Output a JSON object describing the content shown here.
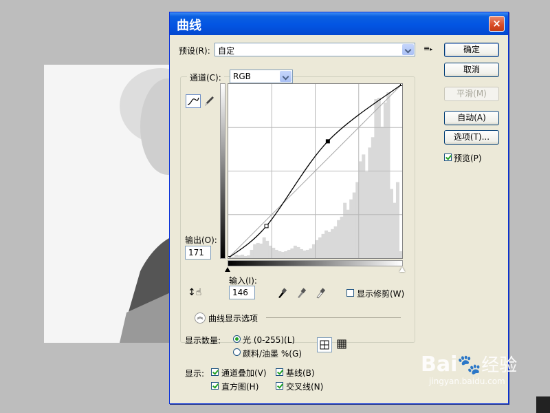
{
  "dialog": {
    "title": "曲线",
    "close_label": "×"
  },
  "preset": {
    "label": "预设(R):",
    "value": "自定"
  },
  "channel": {
    "label": "通道(C):",
    "value": "RGB"
  },
  "buttons": {
    "ok": "确定",
    "cancel": "取消",
    "smooth": "平滑(M)",
    "auto": "自动(A)",
    "options": "选项(T)..."
  },
  "preview": {
    "label": "预览(P)",
    "checked": true
  },
  "output": {
    "label": "输出(O):",
    "value": "171"
  },
  "input": {
    "label": "输入(I):",
    "value": "146"
  },
  "show_clipping": {
    "label": "显示修剪(W)",
    "checked": false
  },
  "curve_options": {
    "label": "曲线显示选项"
  },
  "show_amount": {
    "label": "显示数量:",
    "options": [
      {
        "label": "光 (0-255)(L)",
        "selected": true
      },
      {
        "label": "颜料/油墨 %(G)",
        "selected": false
      }
    ]
  },
  "show": {
    "label": "显示:",
    "channel_overlay": {
      "label": "通道叠加(V)",
      "checked": true
    },
    "baseline": {
      "label": "基线(B)",
      "checked": true
    },
    "histogram": {
      "label": "直方图(H)",
      "checked": true
    },
    "intersection": {
      "label": "交叉线(N)",
      "checked": true
    }
  },
  "watermark": {
    "brand": "Bai",
    "brand2": "经验",
    "url": "jingyan.baidu.com"
  },
  "chart_data": {
    "type": "line",
    "xlim": [
      0,
      255
    ],
    "ylim": [
      0,
      255
    ],
    "control_points": [
      {
        "x": 0,
        "y": 0
      },
      {
        "x": 56,
        "y": 47
      },
      {
        "x": 146,
        "y": 171
      },
      {
        "x": 255,
        "y": 255
      }
    ],
    "baseline": [
      [
        0,
        0
      ],
      [
        255,
        255
      ]
    ],
    "histogram": [
      0,
      2,
      5,
      4,
      5,
      3,
      4,
      12,
      20,
      22,
      21,
      30,
      25,
      18,
      15,
      12,
      10,
      9,
      10,
      12,
      14,
      18,
      16,
      13,
      11,
      12,
      14,
      20,
      26,
      30,
      35,
      40,
      38,
      42,
      46,
      55,
      60,
      80,
      70,
      85,
      95,
      110,
      140,
      150,
      125,
      160,
      175,
      230,
      232,
      190,
      225,
      240,
      100,
      80,
      110,
      10
    ],
    "grid": true,
    "grid_divisions": 4
  }
}
